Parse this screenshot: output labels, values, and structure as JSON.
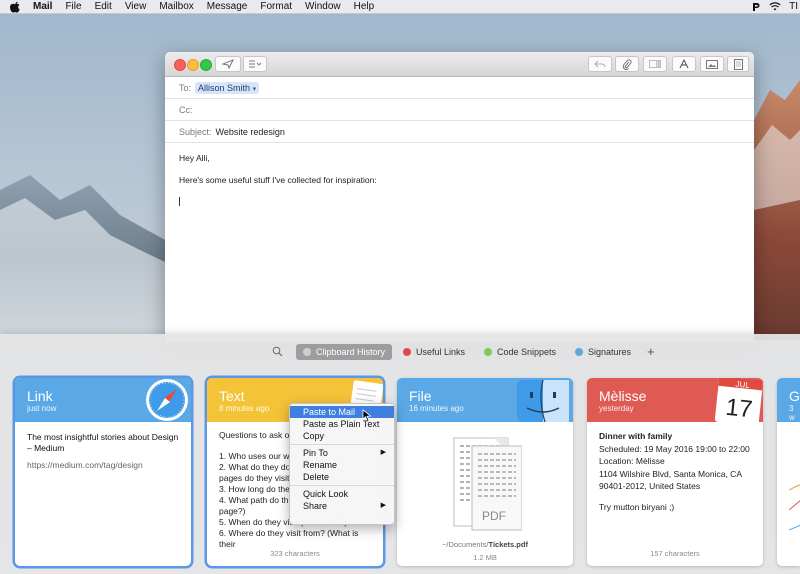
{
  "menubar": {
    "app": "Mail",
    "items": [
      "File",
      "Edit",
      "View",
      "Mailbox",
      "Message",
      "Format",
      "Window",
      "Help"
    ],
    "right_text": "TI"
  },
  "mail": {
    "to_label": "To:",
    "to_value": "Allison Smith",
    "cc_label": "Cc:",
    "subject_label": "Subject:",
    "subject_value": "Website redesign",
    "body_line1": "Hey Alli,",
    "body_line2": "Here's some useful stuff I've collected for inspiration:"
  },
  "panel": {
    "tabs": [
      {
        "label": "Clipboard History",
        "color": "#c8c8c8",
        "active": true
      },
      {
        "label": "Useful Links",
        "color": "#e0474c"
      },
      {
        "label": "Code Snippets",
        "color": "#7fc860"
      },
      {
        "label": "Signatures",
        "color": "#5aa8e0"
      }
    ],
    "plus": "+"
  },
  "cards": {
    "link": {
      "title": "Link",
      "subtitle": "just now",
      "color": "#5aa8e6",
      "heading": "The most insightful stories about Design – Medium",
      "url": "https://medium.com/tag/design"
    },
    "text": {
      "title": "Text",
      "subtitle": "8 minutes ago",
      "color": "#f5c338",
      "intro": "Questions to ask ou",
      "lines": [
        "1. Who uses our we",
        "2. What do they do",
        "pages do they visit?",
        "3. How long do they",
        "4. What path do the",
        "page?)",
        "5. When do they visit (what time?)",
        "6. Where do they visit from? (What is their"
      ],
      "footer": "323 characters"
    },
    "file": {
      "title": "File",
      "subtitle": "16 minutes ago",
      "color": "#5aa8e6",
      "pdf_label": "PDF",
      "path_prefix": "~/Documents/",
      "path_file": "Tickets.pdf",
      "size": "1.2 MB"
    },
    "note": {
      "title": "Mèlisse",
      "subtitle": "yesterday",
      "color": "#df5a52",
      "cal_month": "JUL",
      "cal_day": "17",
      "heading": "Dinner with family",
      "lines": [
        "Scheduled: 19 May 2016 19:00 to 22:00",
        "Location: Mèlisse",
        "1104 Wilshire Blvd, Santa Monica, CA 90401-2012, United States",
        "",
        "Try mutton biryani ;)"
      ],
      "footer": "157 characters"
    },
    "partial": {
      "title": "G",
      "subtitle": "3 w",
      "color": "#5aa8e6"
    }
  },
  "context_menu": {
    "items": [
      {
        "label": "Paste to Mail",
        "highlighted": true
      },
      {
        "label": "Paste as Plain Text"
      },
      {
        "label": "Copy"
      },
      {
        "sep": true
      },
      {
        "label": "Pin To",
        "submenu": true
      },
      {
        "label": "Rename"
      },
      {
        "label": "Delete"
      },
      {
        "sep": true
      },
      {
        "label": "Quick Look"
      },
      {
        "label": "Share",
        "submenu": true
      }
    ]
  }
}
